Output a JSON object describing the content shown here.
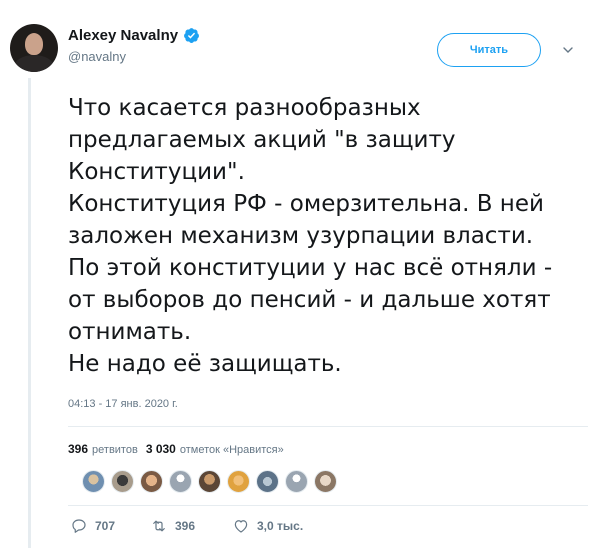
{
  "author": {
    "display_name": "Alexey Navalny",
    "handle": "@navalny",
    "verified_icon": "verified-badge-icon"
  },
  "follow_button": {
    "label": "Читать"
  },
  "menu": {
    "icon": "chevron-down-icon"
  },
  "tweet": {
    "lines": [
      "Что касается разнообразных",
      "предлагаемых акций \"в защиту",
      "Конституции\".",
      "Конституция РФ - омерзительна. В ней",
      "заложен механизм узурпации власти.",
      "По этой конституции у нас всё отняли -",
      "от выборов до пенсий - и дальше хотят",
      "отнимать.",
      "Не надо её защищать."
    ],
    "timestamp": "04:13 - 17 янв. 2020 г."
  },
  "stats": {
    "retweets_count": "396",
    "retweets_label": "ретвитов",
    "likes_count": "3 030",
    "likes_label": "отметок «Нравится»"
  },
  "actions": {
    "reply_count": "707",
    "retweet_count": "396",
    "like_count": "3,0 тыс."
  },
  "colors": {
    "accent": "#1da1f2",
    "muted": "#657786",
    "text": "#14171a",
    "border": "#e6ecf0"
  }
}
